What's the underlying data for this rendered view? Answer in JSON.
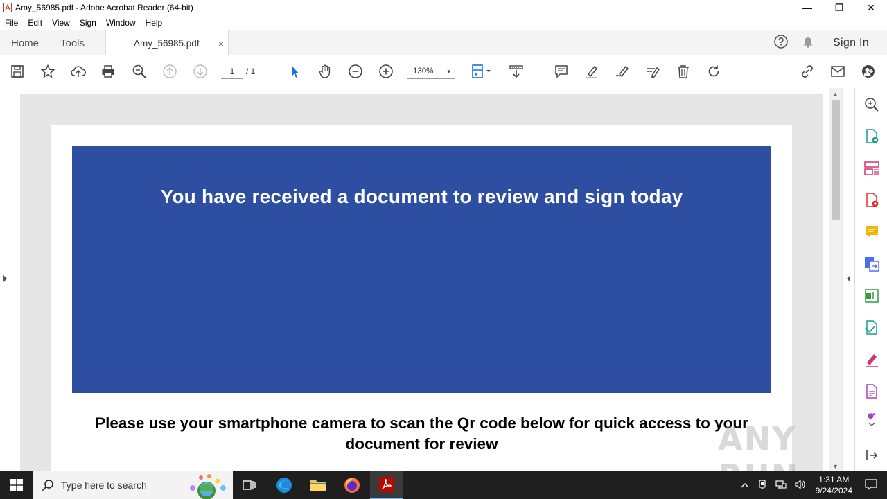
{
  "window": {
    "title": "Amy_56985.pdf - Adobe Acrobat Reader (64-bit)",
    "controls": {
      "minimize": "—",
      "maximize": "❐",
      "close": "✕"
    }
  },
  "menu": [
    "File",
    "Edit",
    "View",
    "Sign",
    "Window",
    "Help"
  ],
  "tabs": {
    "home": "Home",
    "tools": "Tools",
    "document": "Amy_56985.pdf",
    "close": "×",
    "sign_in": "Sign In"
  },
  "toolbar": {
    "page_current": "1",
    "page_total": "/ 1",
    "zoom": "130%",
    "zoom_caret": "▾"
  },
  "document": {
    "banner_text": "You have received a document to review and sign today",
    "instruction": "Please use your smartphone camera to scan the Qr code below for quick access to your document for review",
    "banner_color": "#2e4fa1"
  },
  "scrollbar": {
    "up": "▲",
    "down": "▼"
  },
  "watermark": "ANY RUN",
  "taskbar": {
    "search_placeholder": "Type here to search",
    "time": "1:31 AM",
    "date": "9/24/2024"
  },
  "colors": {
    "accent": "#1473e6",
    "acrobat_red": "#b30b00",
    "taskbar": "#1f1f1f"
  }
}
